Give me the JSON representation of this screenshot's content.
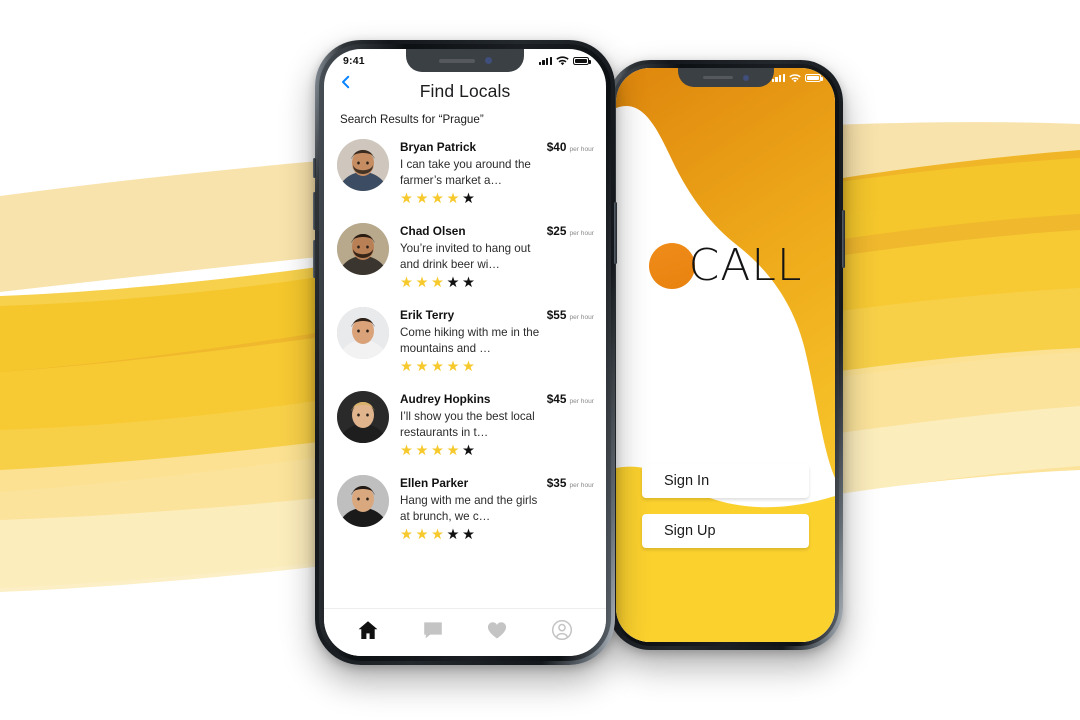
{
  "background": {
    "base_color": "#ffffff",
    "wave_colors": [
      "#F7DE9C",
      "#F5CE6B",
      "#F6C22E",
      "#EFAF16",
      "#FBE5A8",
      "#FCEFC6"
    ]
  },
  "front_phone": {
    "status_bar": {
      "time": "9:41",
      "signal_icon": "signal-bars-icon",
      "wifi_icon": "wifi-icon",
      "battery_icon": "battery-icon"
    },
    "header": {
      "back_icon": "chevron-left-icon",
      "back_color": "#0a84ff",
      "title": "Find Locals",
      "subtitle": "Search Results for “Prague”"
    },
    "rate_suffix": "per hour",
    "star_on_color": "#F6C92D",
    "star_off_color": "#111111",
    "listings": [
      {
        "name": "Bryan Patrick",
        "price": "$40",
        "rate": "per hour",
        "description": "I can take you around the farmer’s market a…",
        "stars_filled": 4,
        "stars_total": 5,
        "avatar": "photo-bearded-man-plaid-shirt"
      },
      {
        "name": "Chad Olsen",
        "price": "$25",
        "rate": "per hour",
        "description": "You’re invited to hang out and drink beer wi…",
        "stars_filled": 3,
        "stars_total": 5,
        "avatar": "photo-bearded-man-dark-shirt"
      },
      {
        "name": "Erik Terry",
        "price": "$55",
        "rate": "per hour",
        "description": "Come hiking with me in the mountains and …",
        "stars_filled": 5,
        "stars_total": 5,
        "avatar": "photo-young-man-white-collar"
      },
      {
        "name": "Audrey Hopkins",
        "price": "$45",
        "rate": "per hour",
        "description": "I’ll show you the best local restaurants in t…",
        "stars_filled": 4,
        "stars_total": 5,
        "avatar": "photo-blonde-woman"
      },
      {
        "name": "Ellen Parker",
        "price": "$35",
        "rate": "per hour",
        "description": "Hang with me and the girls at brunch, we c…",
        "stars_filled": 3,
        "stars_total": 5,
        "avatar": "photo-dark-haired-woman"
      }
    ],
    "tabbar": [
      {
        "icon": "home-icon",
        "label": "Home",
        "active": true
      },
      {
        "icon": "chat-bubble-icon",
        "label": "Messages",
        "active": false
      },
      {
        "icon": "heart-icon",
        "label": "Favorites",
        "active": false
      },
      {
        "icon": "profile-icon",
        "label": "Profile",
        "active": false
      }
    ]
  },
  "back_phone": {
    "status_bar": {
      "signal_icon": "signal-bars-icon",
      "wifi_icon": "wifi-icon",
      "battery_icon": "battery-icon"
    },
    "logo": {
      "mark": "orange-circle-o",
      "mark_color": "#EE8913",
      "text": "CALL"
    },
    "buttons": [
      {
        "label": "Sign In"
      },
      {
        "label": "Sign Up"
      }
    ],
    "theme": {
      "top_gradient_start": "#E08A10",
      "top_gradient_end": "#F9C92B",
      "bottom_color": "#FBD12E"
    }
  }
}
